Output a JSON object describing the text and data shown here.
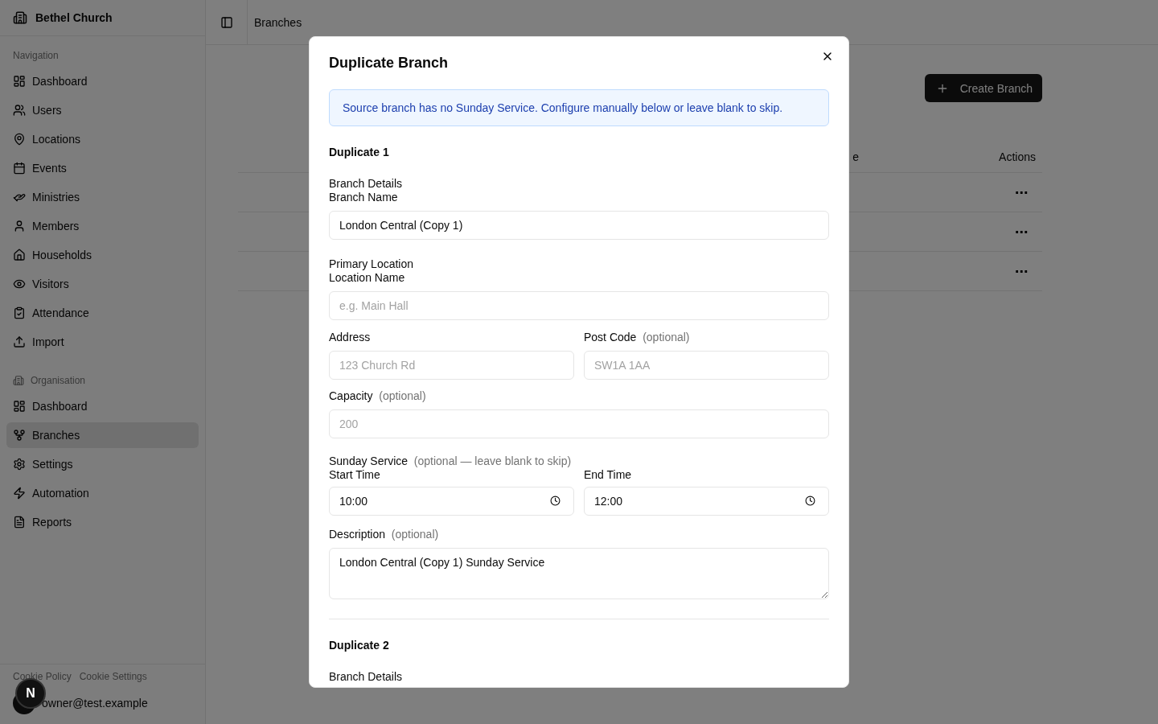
{
  "sidebar": {
    "brand": "Bethel Church",
    "sections": [
      {
        "title": "Navigation",
        "items": [
          {
            "label": "Dashboard",
            "selected": false
          },
          {
            "label": "Users",
            "selected": false
          },
          {
            "label": "Locations",
            "selected": false
          },
          {
            "label": "Events",
            "selected": false
          },
          {
            "label": "Ministries",
            "selected": false
          },
          {
            "label": "Members",
            "selected": false
          },
          {
            "label": "Households",
            "selected": false
          },
          {
            "label": "Visitors",
            "selected": false
          },
          {
            "label": "Attendance",
            "selected": false
          },
          {
            "label": "Import",
            "selected": false
          }
        ]
      },
      {
        "title": "Organisation",
        "items": [
          {
            "label": "Dashboard",
            "selected": false
          },
          {
            "label": "Branches",
            "selected": true
          },
          {
            "label": "Settings",
            "selected": false
          },
          {
            "label": "Automation",
            "selected": false
          },
          {
            "label": "Reports",
            "selected": false
          }
        ]
      }
    ],
    "footer_links": [
      "Cookie Policy",
      "Cookie Settings"
    ],
    "user_email": "owner@test.example"
  },
  "header": {
    "breadcrumb": "Branches"
  },
  "page": {
    "create_button": "Create Branch",
    "table": {
      "columns": [
        "e",
        "Actions"
      ],
      "rows": [
        {
          "column_2": "⋯"
        },
        {
          "column_2": "⋯"
        },
        {
          "column_2": "⋯"
        }
      ]
    }
  },
  "dev_badge": "N",
  "modal": {
    "title": "Duplicate Branch",
    "notice": "Source branch has no Sunday Service. Configure manually below or leave blank to skip.",
    "duplicates": [
      {
        "heading": "Duplicate 1",
        "details_label": "Branch Details",
        "branch_name": {
          "label": "Branch Name",
          "value": "London Central (Copy 1)"
        },
        "location_label": "Primary Location",
        "location_name": {
          "label": "Location Name",
          "placeholder": "e.g. Main Hall"
        },
        "address": {
          "label": "Address",
          "placeholder": "123 Church Rd"
        },
        "post_code": {
          "label": "Post Code",
          "hint": "(optional)",
          "placeholder": "SW1A 1AA"
        },
        "capacity": {
          "label": "Capacity",
          "hint": "(optional)",
          "placeholder": "200"
        },
        "sunday_service": {
          "label": "Sunday Service",
          "hint": "(optional — leave blank to skip)",
          "start_time": {
            "label": "Start Time",
            "value": "10:00"
          },
          "end_time": {
            "label": "End Time",
            "value": "12:00"
          }
        },
        "description": {
          "label": "Description",
          "hint": "(optional)",
          "value": "London Central (Copy 1) Sunday Service"
        }
      },
      {
        "heading": "Duplicate 2",
        "details_label": "Branch Details"
      }
    ]
  }
}
